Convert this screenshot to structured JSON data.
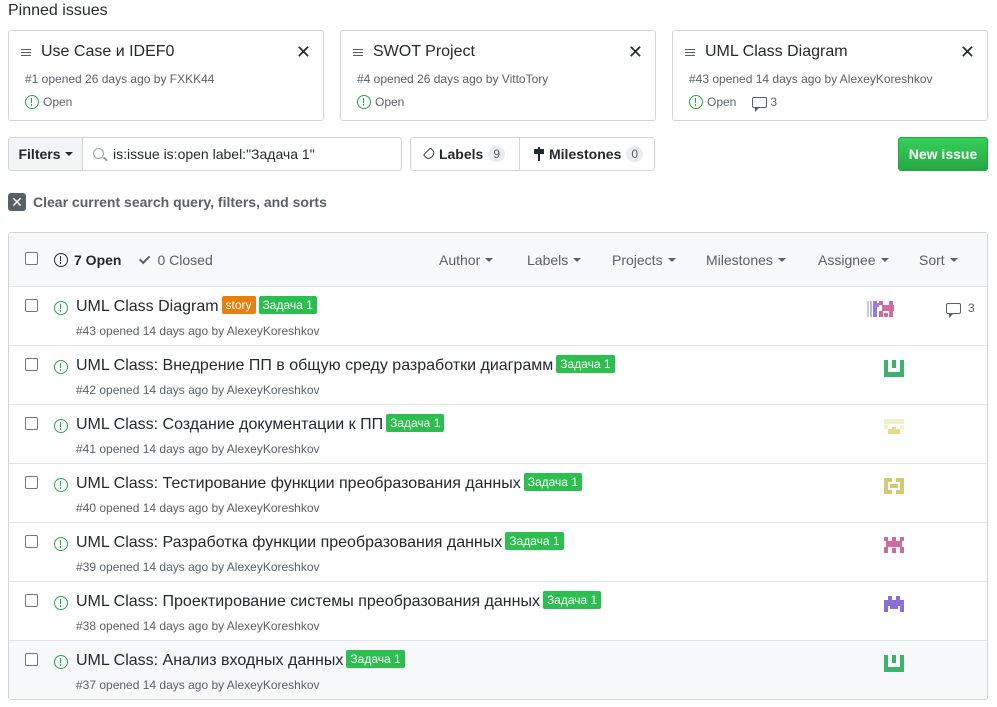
{
  "pinned": {
    "heading": "Pinned issues",
    "cards": [
      {
        "title": "Use Case и IDEF0",
        "meta": "#1 opened 26 days ago by FXKK44",
        "state": "Open",
        "comments": ""
      },
      {
        "title": "SWOT Project",
        "meta": "#4 opened 26 days ago by VittoTory",
        "state": "Open",
        "comments": ""
      },
      {
        "title": "UML Class Diagram",
        "meta": "#43 opened 14 days ago by AlexeyKoreshkov",
        "state": "Open",
        "comments": "3"
      }
    ]
  },
  "toolbar": {
    "filters_label": "Filters",
    "search_value": "is:issue is:open label:\"Задача 1\"",
    "labels_label": "Labels",
    "labels_count": "9",
    "milestones_label": "Milestones",
    "milestones_count": "0",
    "new_issue_label": "New issue"
  },
  "clear_label": "Clear current search query, filters, and sorts",
  "header": {
    "open_label": "7 Open",
    "closed_label": "0 Closed",
    "filters": [
      "Author",
      "Labels",
      "Projects",
      "Milestones",
      "Assignee",
      "Sort"
    ]
  },
  "colors": {
    "open_green": "#28a745",
    "label_story": "#e7800e",
    "label_task": "#2cbe4e"
  },
  "issues": [
    {
      "title": "UML Class Diagram",
      "labels": [
        "story",
        "Задача 1"
      ],
      "meta": "#43 opened 14 days ago by AlexeyKoreshkov",
      "comments": "3",
      "avatar": "multi-avatar"
    },
    {
      "title": "UML Class: Внедрение ПП в общую среду разработки диаграмм",
      "labels": [
        "Задача 1"
      ],
      "meta": "#42 opened 14 days ago by AlexeyKoreshkov",
      "comments": "",
      "avatar": "green-identicon"
    },
    {
      "title": "UML Class: Создание документации к ПП",
      "labels": [
        "Задача 1"
      ],
      "meta": "#41 opened 14 days ago by AlexeyKoreshkov",
      "comments": "",
      "avatar": "yellow-identicon"
    },
    {
      "title": "UML Class: Тестирование функции преобразования данных",
      "labels": [
        "Задача 1"
      ],
      "meta": "#40 opened 14 days ago by AlexeyKoreshkov",
      "comments": "",
      "avatar": "olive-identicon"
    },
    {
      "title": "UML Class: Разработка функции преобразования данных",
      "labels": [
        "Задача 1"
      ],
      "meta": "#39 opened 14 days ago by AlexeyKoreshkov",
      "comments": "",
      "avatar": "pink-identicon"
    },
    {
      "title": "UML Class: Проектирование системы преобразования данных",
      "labels": [
        "Задача 1"
      ],
      "meta": "#38 opened 14 days ago by AlexeyKoreshkov",
      "comments": "",
      "avatar": "purple-identicon"
    },
    {
      "title": "UML Class: Анализ входных данных",
      "labels": [
        "Задача 1"
      ],
      "meta": "#37 opened 14 days ago by AlexeyKoreshkov",
      "comments": "",
      "avatar": "green-identicon"
    }
  ]
}
